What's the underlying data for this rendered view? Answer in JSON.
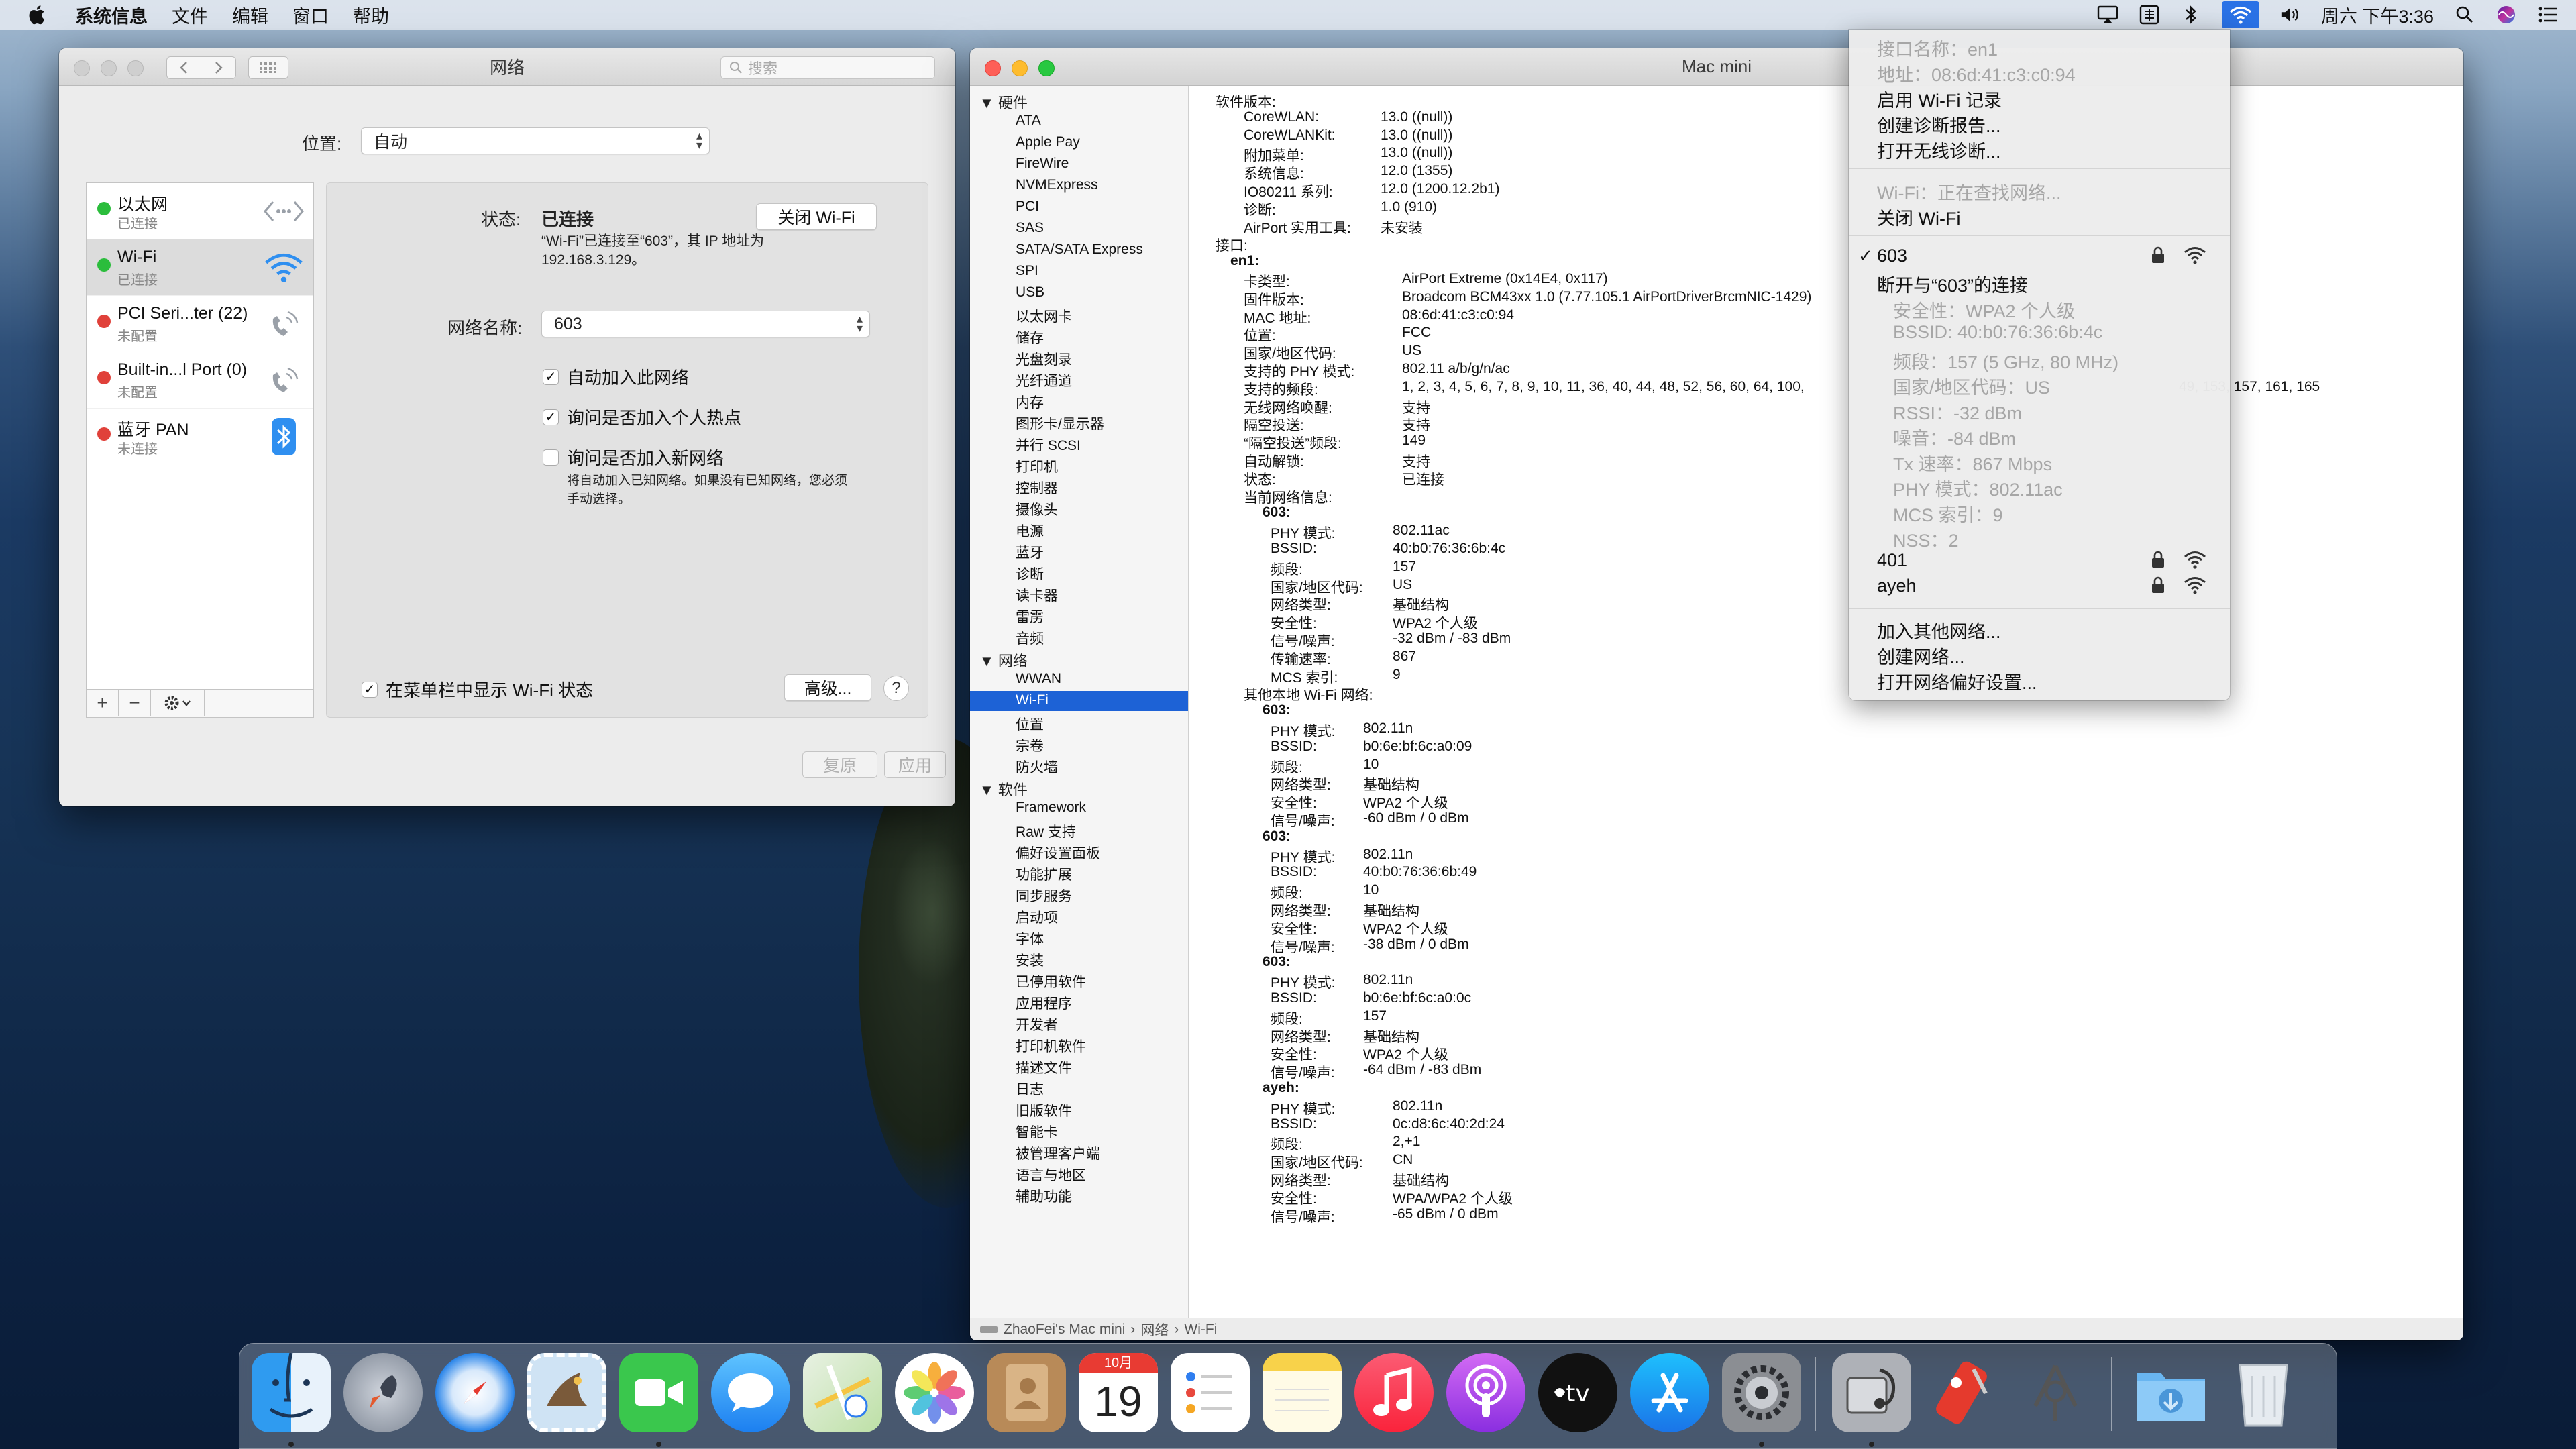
{
  "menubar": {
    "app": "系统信息",
    "items": [
      "文件",
      "编辑",
      "窗口",
      "帮助"
    ],
    "clock": "周六 下午3:36"
  },
  "network_window": {
    "title": "网络",
    "search_placeholder": "搜索",
    "location_label": "位置:",
    "location_value": "自动",
    "services": [
      {
        "name": "以太网",
        "status": "已连接",
        "dot": "#2bbd3c",
        "icon": "ethernet-icon"
      },
      {
        "name": "Wi-Fi",
        "status": "已连接",
        "dot": "#2bbd3c",
        "icon": "wifi-icon"
      },
      {
        "name": "PCI Seri...ter (22)",
        "status": "未配置",
        "dot": "#e0413a",
        "icon": "phone-icon"
      },
      {
        "name": "Built-in...l Port (0)",
        "status": "未配置",
        "dot": "#e0413a",
        "icon": "phone-icon"
      },
      {
        "name": "蓝牙 PAN",
        "status": "未连接",
        "dot": "#e0413a",
        "icon": "bluetooth-icon"
      }
    ],
    "status_label": "状态:",
    "status_value": "已连接",
    "turn_off_wifi": "关闭 Wi-Fi",
    "status_desc_1": "“Wi-Fi”已连接至“603”，其 IP 地址为",
    "status_desc_2": "192.168.3.129。",
    "network_name_label": "网络名称:",
    "network_name_value": "603",
    "checkbox_auto_join": "自动加入此网络",
    "checkbox_ask_hotspot": "询问是否加入个人热点",
    "checkbox_ask_new": "询问是否加入新网络",
    "ask_new_desc_1": "将自动加入已知网络。如果没有已知网络，您必须",
    "ask_new_desc_2": "手动选择。",
    "show_status_menu": "在菜单栏中显示 Wi-Fi 状态",
    "advanced": "高级...",
    "help": "?",
    "revert": "复原",
    "apply": "应用"
  },
  "sysinfo_window": {
    "title": "Mac mini",
    "sidebar": {
      "hardware_header": "硬件",
      "hardware": [
        "ATA",
        "Apple Pay",
        "FireWire",
        "NVMExpress",
        "PCI",
        "SAS",
        "SATA/SATA Express",
        "SPI",
        "USB",
        "以太网卡",
        "储存",
        "光盘刻录",
        "光纤通道",
        "内存",
        "图形卡/显示器",
        "并行 SCSI",
        "打印机",
        "控制器",
        "摄像头",
        "电源",
        "蓝牙",
        "诊断",
        "读卡器",
        "雷雳",
        "音频"
      ],
      "network_header": "网络",
      "network": [
        "WWAN",
        "Wi-Fi",
        "位置",
        "宗卷",
        "防火墙"
      ],
      "software_header": "软件",
      "software": [
        "Framework",
        "Raw 支持",
        "偏好设置面板",
        "功能扩展",
        "同步服务",
        "启动项",
        "字体",
        "安装",
        "已停用软件",
        "应用程序",
        "开发者",
        "打印机软件",
        "描述文件",
        "日志",
        "旧版软件",
        "智能卡",
        "被管理客户端",
        "语言与地区",
        "辅助功能"
      ]
    },
    "software_versions": {
      "header": "软件版本:",
      "rows": [
        [
          "CoreWLAN:",
          "13.0 ((null))"
        ],
        [
          "CoreWLANKit:",
          "13.0 ((null))"
        ],
        [
          "附加菜单:",
          "13.0 ((null))"
        ],
        [
          "系统信息:",
          "12.0 (1355)"
        ],
        [
          "IO80211 系列:",
          "12.0 (1200.12.2b1)"
        ],
        [
          "诊断:",
          "1.0 (910)"
        ],
        [
          "AirPort 实用工具:",
          "未安装"
        ]
      ]
    },
    "interfaces_header": "接口:",
    "en1_header": "en1:",
    "en1_rows": [
      [
        "卡类型:",
        "AirPort Extreme  (0x14E4, 0x117)"
      ],
      [
        "固件版本:",
        "Broadcom BCM43xx 1.0 (7.77.105.1 AirPortDriverBrcmNIC-1429)"
      ],
      [
        "MAC 地址:",
        "08:6d:41:c3:c0:94"
      ],
      [
        "位置:",
        "FCC"
      ],
      [
        "国家/地区代码:",
        "US"
      ],
      [
        "支持的 PHY 模式:",
        "802.11 a/b/g/n/ac"
      ],
      [
        "支持的频段:",
        "1, 2, 3, 4, 5, 6, 7, 8, 9, 10, 11, 36, 40, 44, 48, 52, 56, 60, 64, 100,"
      ],
      [
        "无线网络唤醒:",
        "支持"
      ],
      [
        "隔空投送:",
        "支持"
      ],
      [
        "“隔空投送”频段:",
        "149"
      ],
      [
        "自动解锁:",
        "支持"
      ],
      [
        "状态:",
        "已连接"
      ]
    ],
    "channels_tail": "49, 153, 157, 161, 165",
    "current_network_header": "当前网络信息:",
    "current_network_name": "603:",
    "current_network_rows": [
      [
        "PHY 模式:",
        "802.11ac"
      ],
      [
        "BSSID:",
        "40:b0:76:36:6b:4c"
      ],
      [
        "频段:",
        "157"
      ],
      [
        "国家/地区代码:",
        "US"
      ],
      [
        "网络类型:",
        "基础结构"
      ],
      [
        "安全性:",
        "WPA2 个人级"
      ],
      [
        "信号/噪声:",
        "-32 dBm / -83 dBm"
      ],
      [
        "传输速率:",
        "867"
      ],
      [
        "MCS 索引:",
        "9"
      ]
    ],
    "other_networks_header": "其他本地 Wi-Fi 网络:",
    "other_networks": [
      {
        "name": "603:",
        "rows": [
          [
            "PHY 模式:",
            "802.11n"
          ],
          [
            "BSSID:",
            "b0:6e:bf:6c:a0:09"
          ],
          [
            "频段:",
            "10"
          ],
          [
            "网络类型:",
            "基础结构"
          ],
          [
            "安全性:",
            "WPA2 个人级"
          ],
          [
            "信号/噪声:",
            "-60 dBm / 0 dBm"
          ]
        ]
      },
      {
        "name": "603:",
        "rows": [
          [
            "PHY 模式:",
            "802.11n"
          ],
          [
            "BSSID:",
            "40:b0:76:36:6b:49"
          ],
          [
            "频段:",
            "10"
          ],
          [
            "网络类型:",
            "基础结构"
          ],
          [
            "安全性:",
            "WPA2 个人级"
          ],
          [
            "信号/噪声:",
            "-38 dBm / 0 dBm"
          ]
        ]
      },
      {
        "name": "603:",
        "rows": [
          [
            "PHY 模式:",
            "802.11n"
          ],
          [
            "BSSID:",
            "b0:6e:bf:6c:a0:0c"
          ],
          [
            "频段:",
            "157"
          ],
          [
            "网络类型:",
            "基础结构"
          ],
          [
            "安全性:",
            "WPA2 个人级"
          ],
          [
            "信号/噪声:",
            "-64 dBm / -83 dBm"
          ]
        ]
      },
      {
        "name": "ayeh:",
        "rows": [
          [
            "PHY 模式:",
            "802.11n"
          ],
          [
            "BSSID:",
            "0c:d8:6c:40:2d:24"
          ],
          [
            "频段:",
            "2,+1"
          ],
          [
            "国家/地区代码:",
            "CN"
          ],
          [
            "网络类型:",
            "基础结构"
          ],
          [
            "安全性:",
            "WPA/WPA2 个人级"
          ],
          [
            "信号/噪声:",
            "-65 dBm / 0 dBm"
          ]
        ]
      }
    ],
    "path": [
      "ZhaoFei's Mac mini",
      "网络",
      "Wi-Fi"
    ]
  },
  "wifi_menu": {
    "iface_name": "接口名称：en1",
    "address": "地址：08:6d:41:c3:c0:94",
    "enable_logging": "启用 Wi-Fi 记录",
    "create_report": "创建诊断报告...",
    "open_diagnostics": "打开无线诊断...",
    "wifi_status": "Wi-Fi：正在查找网络...",
    "turn_off": "关闭 Wi-Fi",
    "current_network": "603",
    "disconnect": "断开与“603”的连接",
    "details": [
      "安全性：WPA2 个人级",
      "BSSID: 40:b0:76:36:6b:4c",
      "频段：157 (5 GHz, 80 MHz)",
      "国家/地区代码：US",
      "RSSI：-32 dBm",
      "噪音：-84 dBm",
      "Tx 速率：867 Mbps",
      "PHY 模式：802.11ac",
      "MCS 索引：9",
      "NSS：2"
    ],
    "networks": [
      "401",
      "ayeh"
    ],
    "join_other": "加入其他网络...",
    "create_network": "创建网络...",
    "open_prefs": "打开网络偏好设置..."
  },
  "dock": {
    "day": "19",
    "month": "10月",
    "apps": [
      "finder-icon",
      "launchpad-icon",
      "safari-icon",
      "mail-icon",
      "facetime-icon",
      "messages-icon",
      "maps-icon",
      "photos-icon",
      "contacts-icon",
      "calendar-icon",
      "reminders-icon",
      "notes-icon",
      "music-icon",
      "podcasts-icon",
      "tv-icon",
      "appstore-icon",
      "system-preferences-icon",
      "system-information-icon",
      "utility-icon",
      "network-utility-icon",
      "downloads-icon",
      "trash-icon"
    ]
  }
}
